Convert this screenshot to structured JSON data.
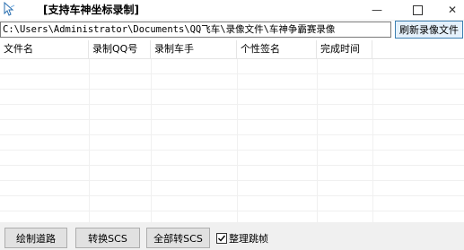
{
  "window": {
    "title": "[支持车神坐标录制]",
    "minimize_glyph": "—",
    "close_glyph": "✕"
  },
  "toolbar": {
    "path_value": "C:\\Users\\Administrator\\Documents\\QQ飞车\\录像文件\\车神争霸赛录像",
    "refresh_label": "刷新录像文件"
  },
  "table": {
    "columns": [
      "文件名",
      "录制QQ号",
      "录制车手",
      "个性签名",
      "完成时间"
    ],
    "rows": []
  },
  "actions": {
    "draw_road_label": "绘制道路",
    "convert_scs_label": "转换SCS",
    "convert_all_scs_label": "全部转SCS",
    "organize_frames_label": "整理跳帧",
    "organize_frames_checked": true
  },
  "icons": {
    "app": "cursor-arrow-icon",
    "minimize": "minimize-icon",
    "maximize": "maximize-icon",
    "close": "close-icon",
    "check": "checkmark-icon"
  },
  "colors": {
    "refresh_button_border": "#3c7fb1",
    "refresh_button_bg": "#e5f1fb",
    "button_bg": "#e1e1e1",
    "bottom_bar_bg": "#f0f0f0"
  }
}
